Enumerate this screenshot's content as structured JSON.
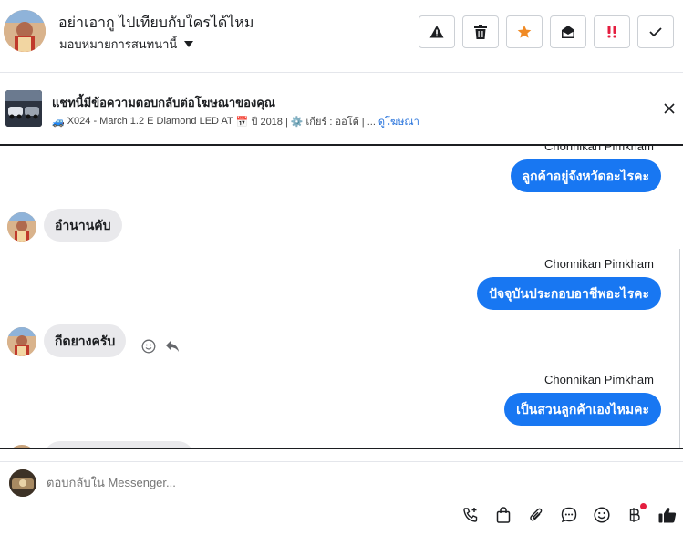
{
  "header": {
    "title": "อย่าเอากู ไปเทียบกับใครได้ไหม",
    "assign_label": "มอบหมายการสนทนานี้",
    "actions": [
      {
        "name": "alert-button",
        "icon": "warning-icon"
      },
      {
        "name": "delete-button",
        "icon": "trash-icon"
      },
      {
        "name": "star-button",
        "icon": "star-icon",
        "color": "#f08a24"
      },
      {
        "name": "mark-unread-button",
        "icon": "envelope-open-icon"
      },
      {
        "name": "priority-button",
        "icon": "exclamation-icon",
        "color": "#e41e3f"
      },
      {
        "name": "done-button",
        "icon": "check-icon"
      }
    ]
  },
  "banner": {
    "title": "แชทนี้มีข้อความตอบกลับต่อโฆษณาของคุณ",
    "sub_car": "🚙",
    "sub_model": "X024 - March 1.2 E Diamond LED AT",
    "sub_cal": "📅",
    "sub_year": "ปี 2018 |",
    "sub_gear_icon": "⚙️",
    "sub_gear": "เกียร์ : ออโต้ | ...",
    "sub_link": "ดูโฆษณา"
  },
  "messages": {
    "m1_sender": "Chonnikan Pimkham",
    "m1_text": "ลูกค้าอยู่จังหวัดอะไรคะ",
    "m2_text": "อำนานคับ",
    "m3_sender": "Chonnikan Pimkham",
    "m3_text": "ปัจจุบันประกอบอาชีพอะไรคะ",
    "m4_text": "กีดยางครับ",
    "m5_sender": "Chonnikan Pimkham",
    "m5_text": "เป็นสวนลูกค้าเองไหมคะ"
  },
  "composer": {
    "placeholder": "ตอบกลับใน Messenger..."
  },
  "colors": {
    "accent": "#1877f2",
    "bubble_in": "#e9e9ec",
    "notification": "#e41e3f"
  }
}
